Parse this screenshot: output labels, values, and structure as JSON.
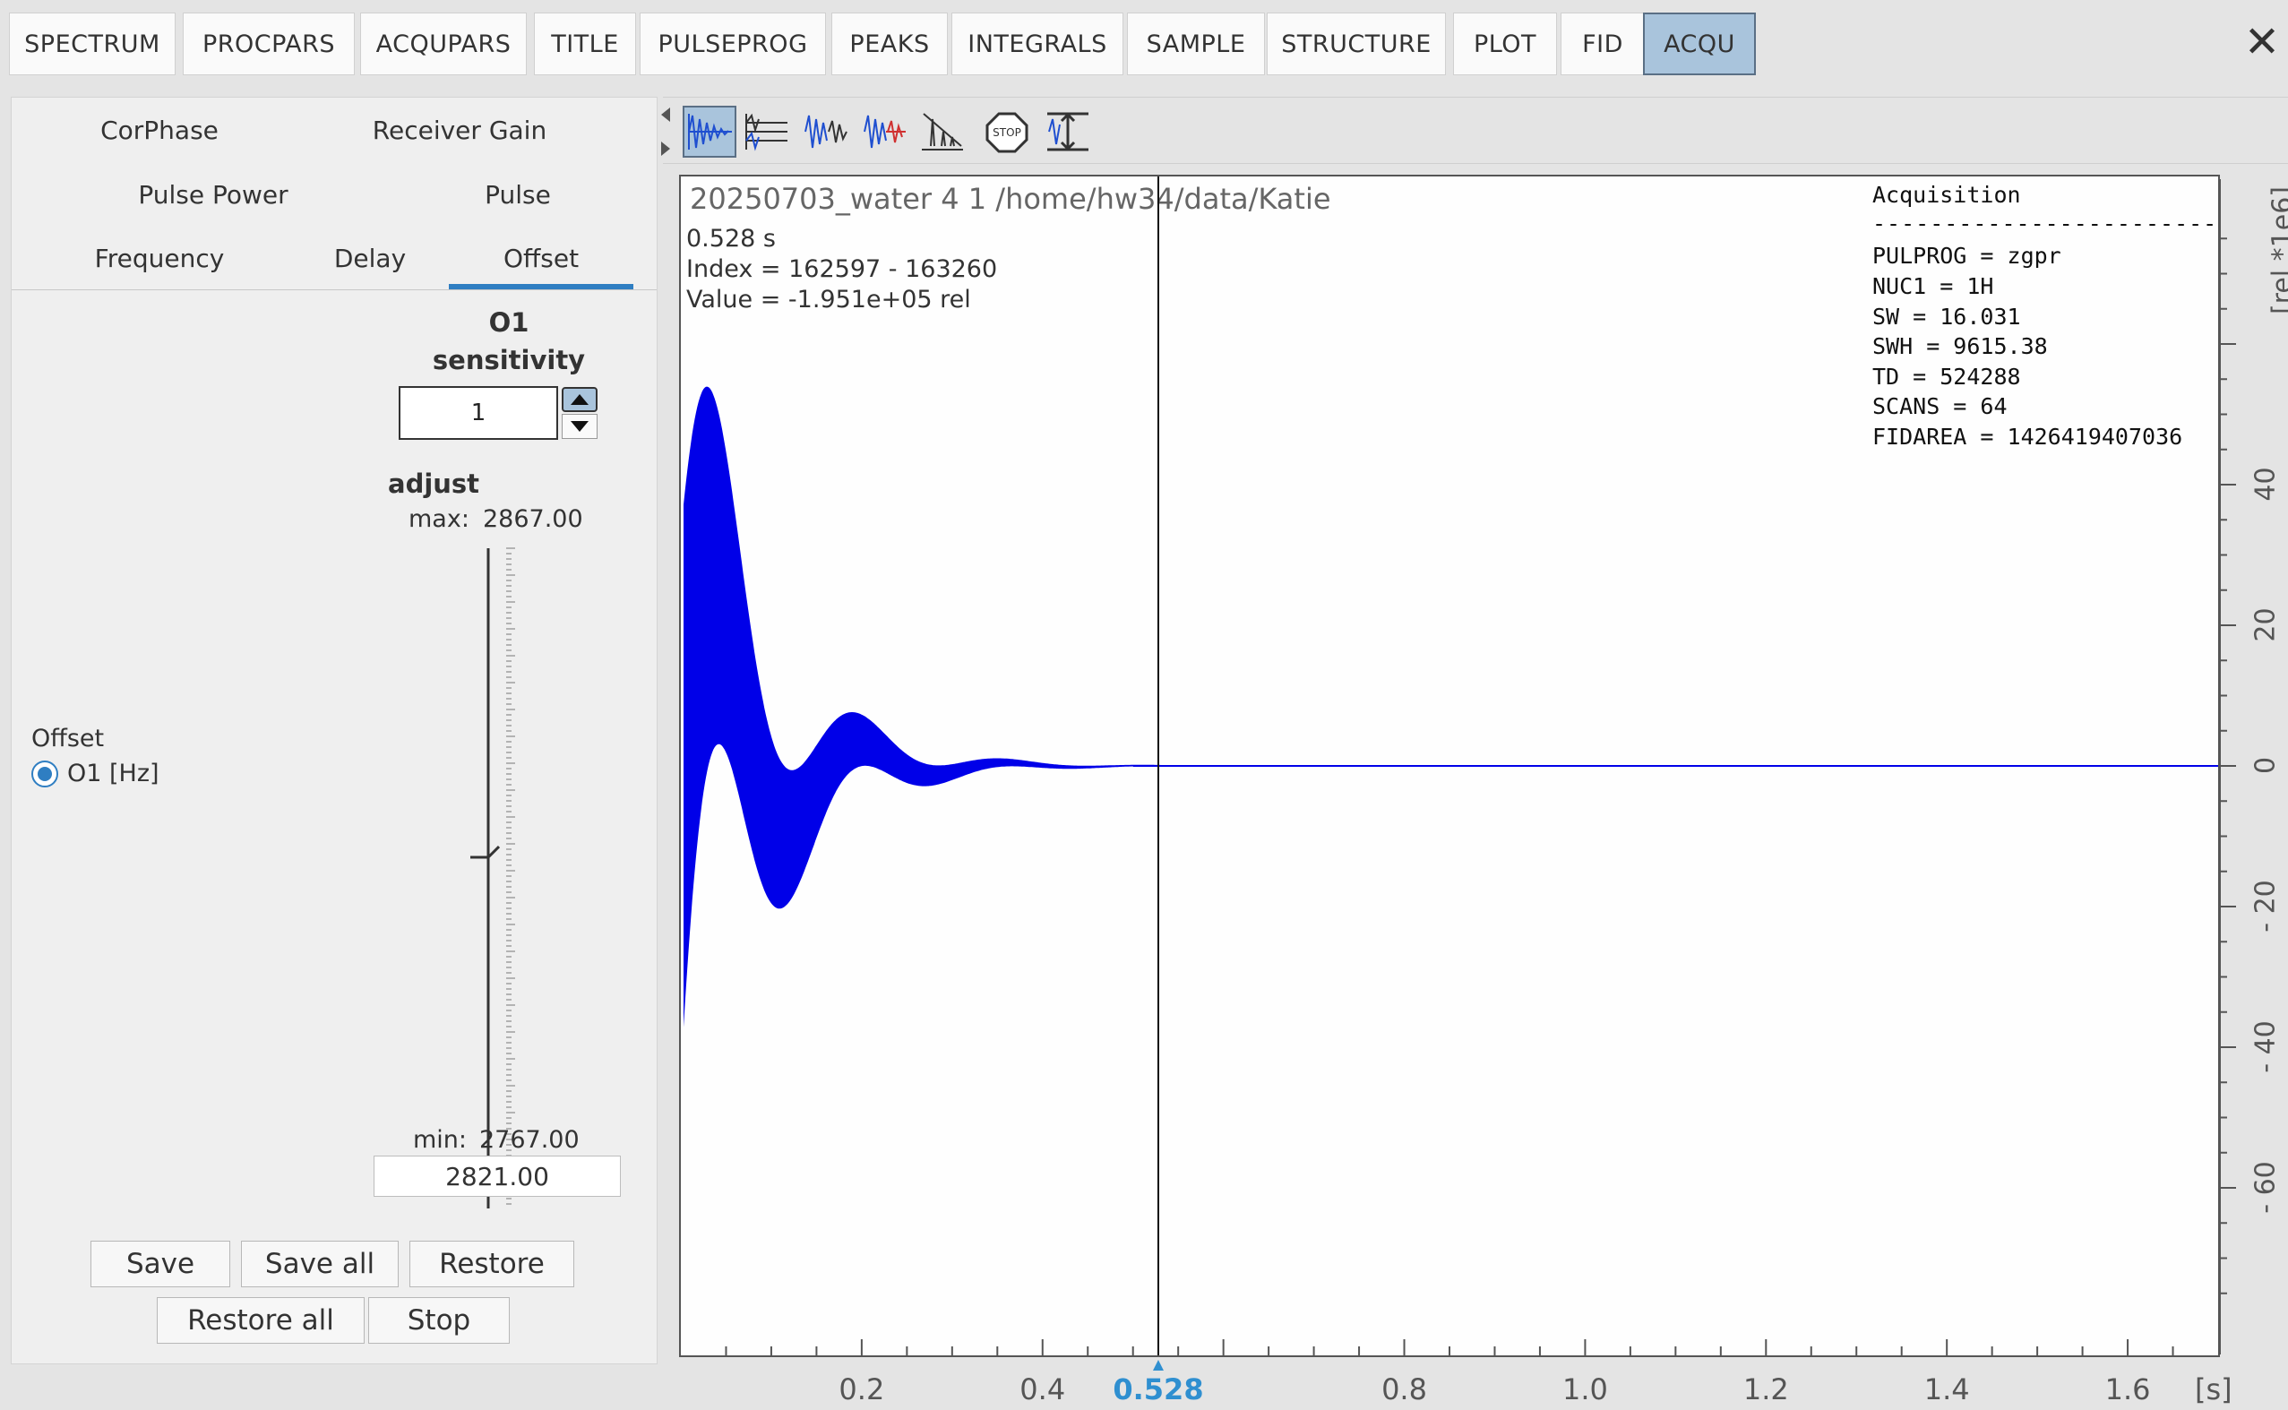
{
  "tabs": [
    "SPECTRUM",
    "PROCPARS",
    "ACQUPARS",
    "TITLE",
    "PULSEPROG",
    "PEAKS",
    "INTEGRALS",
    "SAMPLE",
    "STRUCTURE",
    "PLOT",
    "FID",
    "ACQU"
  ],
  "active_tab": "ACQU",
  "left_panel": {
    "subtabs_row1": [
      "CorPhase",
      "Receiver Gain"
    ],
    "subtabs_row2": [
      "Pulse Power",
      "Pulse"
    ],
    "subtabs_row3": [
      "Frequency",
      "Delay",
      "Offset"
    ],
    "selected_subtab": "Offset",
    "param_title": "O1",
    "sensitivity_label": "sensitivity",
    "sensitivity_value": "1",
    "adjust_label": "adjust",
    "max_label": "max:",
    "max_value": "2867.00",
    "min_label": "min:",
    "min_value": "2767.00",
    "current_value": "2821.00",
    "slider_fraction": 0.54,
    "group_label": "Offset",
    "radio_label": "O1  [Hz]",
    "buttons": {
      "save": "Save",
      "save_all": "Save all",
      "restore": "Restore",
      "restore_all": "Restore all",
      "stop": "Stop"
    }
  },
  "toolbar_icons": [
    "fid-view-icon",
    "multiple-fid-icon",
    "fid-zoom-icon",
    "fid-overlay-icon",
    "peak-pick-icon",
    "stop-icon",
    "fit-view-icon"
  ],
  "plot": {
    "dataset": "20250703_water  4  1  /home/hw34/data/Katie",
    "cursor_time": "0.528 s",
    "cursor_index": "Index = 162597 - 163260",
    "cursor_value": "Value = -1.951e+05 rel",
    "info_title": "Acquisition",
    "info_sep": "------------------------",
    "info_lines": [
      "PULPROG = zgpr",
      "NUC1 = 1H",
      "SW = 16.031",
      "SWH = 9615.38",
      "TD = 524288",
      "SCANS = 64",
      "FIDAREA = 1426419407036"
    ],
    "x_ticks": [
      "0.2",
      "0.4",
      "0.8",
      "1.0",
      "1.2",
      "1.4",
      "1.6"
    ],
    "x_tick_values": [
      0.2,
      0.4,
      0.8,
      1.0,
      1.2,
      1.4,
      1.6
    ],
    "x_unit": "[s]",
    "cursor_x_label": "0.528",
    "cursor_x_value": 0.528,
    "y_ticks": [
      "40",
      "20",
      "0",
      "- 20",
      "- 40",
      "- 60"
    ],
    "y_tick_values": [
      40,
      20,
      0,
      -20,
      -40,
      -60
    ],
    "y_unit": "[rel *1e6]",
    "signal_color": "#0000e8"
  }
}
